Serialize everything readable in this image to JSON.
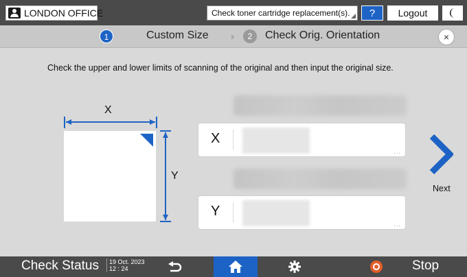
{
  "topbar": {
    "user_name": "LONDON OFFICE",
    "message": "Check toner cartridge replacement(s).",
    "help_label": "?",
    "logout_label": "Logout",
    "moon_icon": "moon-icon"
  },
  "steps": [
    {
      "number": "1",
      "label": "Custom Size",
      "active": true
    },
    {
      "number": "2",
      "label": "Check Orig. Orientation",
      "active": false
    }
  ],
  "close_label": "×",
  "instruction": "Check the upper and lower limits of scanning of the original and then input the original size.",
  "diagram": {
    "x_label": "X",
    "y_label": "Y"
  },
  "fields": [
    {
      "letter": "X",
      "dots": "..."
    },
    {
      "letter": "Y",
      "dots": "..."
    }
  ],
  "next_label": "Next",
  "bottombar": {
    "check_status": "Check Status",
    "date": "19 Oct. 2023",
    "time": "12 : 24",
    "stop_label": "Stop"
  },
  "colors": {
    "accent": "#1d63c5",
    "bar": "#4a4a4a",
    "stop": "#e35e2c",
    "background": "#d9d9d9"
  }
}
